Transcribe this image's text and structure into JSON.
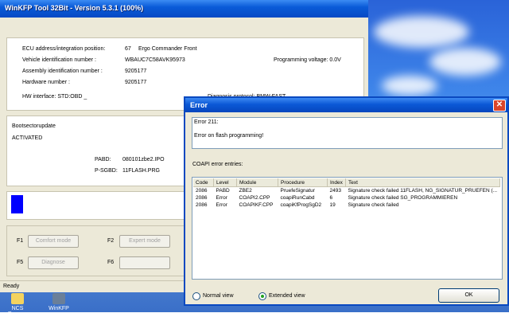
{
  "main_window": {
    "title": "WinKFP Tool 32Bit - Version 5.3.1 (100%)",
    "info": {
      "ecu_label": "ECU address/integration position:",
      "ecu_num": "67",
      "ecu_name": "Ergo Commander Front",
      "vin_label": "Vehicle identification number :",
      "vin_value": "WBAUC7C58AVK95973",
      "voltage": "Programming voltage: 0.0V",
      "assembly_label": "Assembly identification number :",
      "assembly_value": "9205177",
      "hardware_label": "Hardware number :",
      "hardware_value": "9205177",
      "hw_interface": "HW interface:  STD:OBD _",
      "diag_protocol": "Diagnosis protocol:  BMW-FAST"
    },
    "boot": {
      "title": "Bootsectorupdate",
      "status": "ACTIVATED",
      "pabd_label": "PABD:",
      "pabd_value": "080101zbe2.IPO",
      "psgbd_label": "P-SGBD:",
      "psgbd_value": "11FLASH.PRG"
    },
    "progress": 0.05,
    "fkeys": {
      "f1": "F1",
      "f1_btn": "Comfort mode",
      "f2": "F2",
      "f2_btn": "Expert mode",
      "f5": "F5",
      "f5_btn": "Diagnose",
      "f6": "F6",
      "f6_btn": ""
    },
    "status": "Ready"
  },
  "desktop": {
    "icon1": "NCS Dummy",
    "icon2": "WinKFP"
  },
  "dialog": {
    "title": "Error",
    "close": "✕",
    "error_code": "Error 211:",
    "error_msg": "Error on flash programming!",
    "entries_label": "COAPI error entries:",
    "columns": [
      "Code",
      "Level",
      "Module",
      "Procedure",
      "Index",
      "Text"
    ],
    "rows": [
      [
        "2086",
        "PABD",
        "ZBE2",
        "PruefeSignatur",
        "2493",
        "Signature check failed  11FLASH, NG_SIGNATUR_PRUEFEN (..."
      ],
      [
        "2086",
        "Error",
        "COAPI2.CPP",
        "coapiRunCabd",
        "6",
        "Signature check failed  SG_PROGRAMMIEREN"
      ],
      [
        "2086",
        "Error",
        "COAPIKF.CPP",
        "coapiKfProgSgD2",
        "19",
        "Signature check failed"
      ]
    ],
    "normal_view": "Normal view",
    "extended_view": "Extended view",
    "ok": "OK"
  }
}
